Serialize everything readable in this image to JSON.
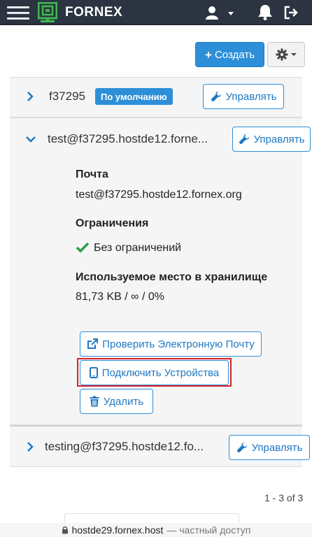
{
  "navbar": {
    "brand": "FORNEX",
    "icons": [
      "menu-icon",
      "fornex-logo-icon",
      "user-icon",
      "caret-down-icon",
      "bell-icon",
      "logout-icon"
    ]
  },
  "toolbar": {
    "create_label": "Создать",
    "settings_icon": "gear-icon"
  },
  "rows": [
    {
      "title": "f37295",
      "badge": "По умолчанию",
      "manage_label": "Управлять",
      "expanded": false
    },
    {
      "title": "test@f37295.hostde12.forne...",
      "manage_label": "Управлять",
      "expanded": true,
      "details": {
        "mail_label": "Почта",
        "mail_value": "test@f37295.hostde12.fornex.org",
        "limits_label": "Ограничения",
        "limits_value": "Без ограничений",
        "storage_label": "Используемое место в хранилище",
        "storage_value": "81,73 KB / ∞ / 0%"
      },
      "actions": {
        "check_mail": "Проверить Электронную Почту",
        "connect_devices": "Подключить Устройства",
        "delete": "Удалить"
      }
    },
    {
      "title": "testing@f37295.hostde12.fo...",
      "manage_label": "Управлять",
      "expanded": false
    }
  ],
  "pagination": {
    "text": "1 - 3 of 3"
  },
  "browser_bar": {
    "host": "hostde29.fornex.host",
    "suffix": "— частный доступ"
  },
  "colors": {
    "navbar_bg": "#2b3440",
    "logo_green": "#3fb950",
    "accent_blue": "#2d8fd8",
    "check_green": "#2e9e4a",
    "highlight_red": "#d9222a"
  }
}
